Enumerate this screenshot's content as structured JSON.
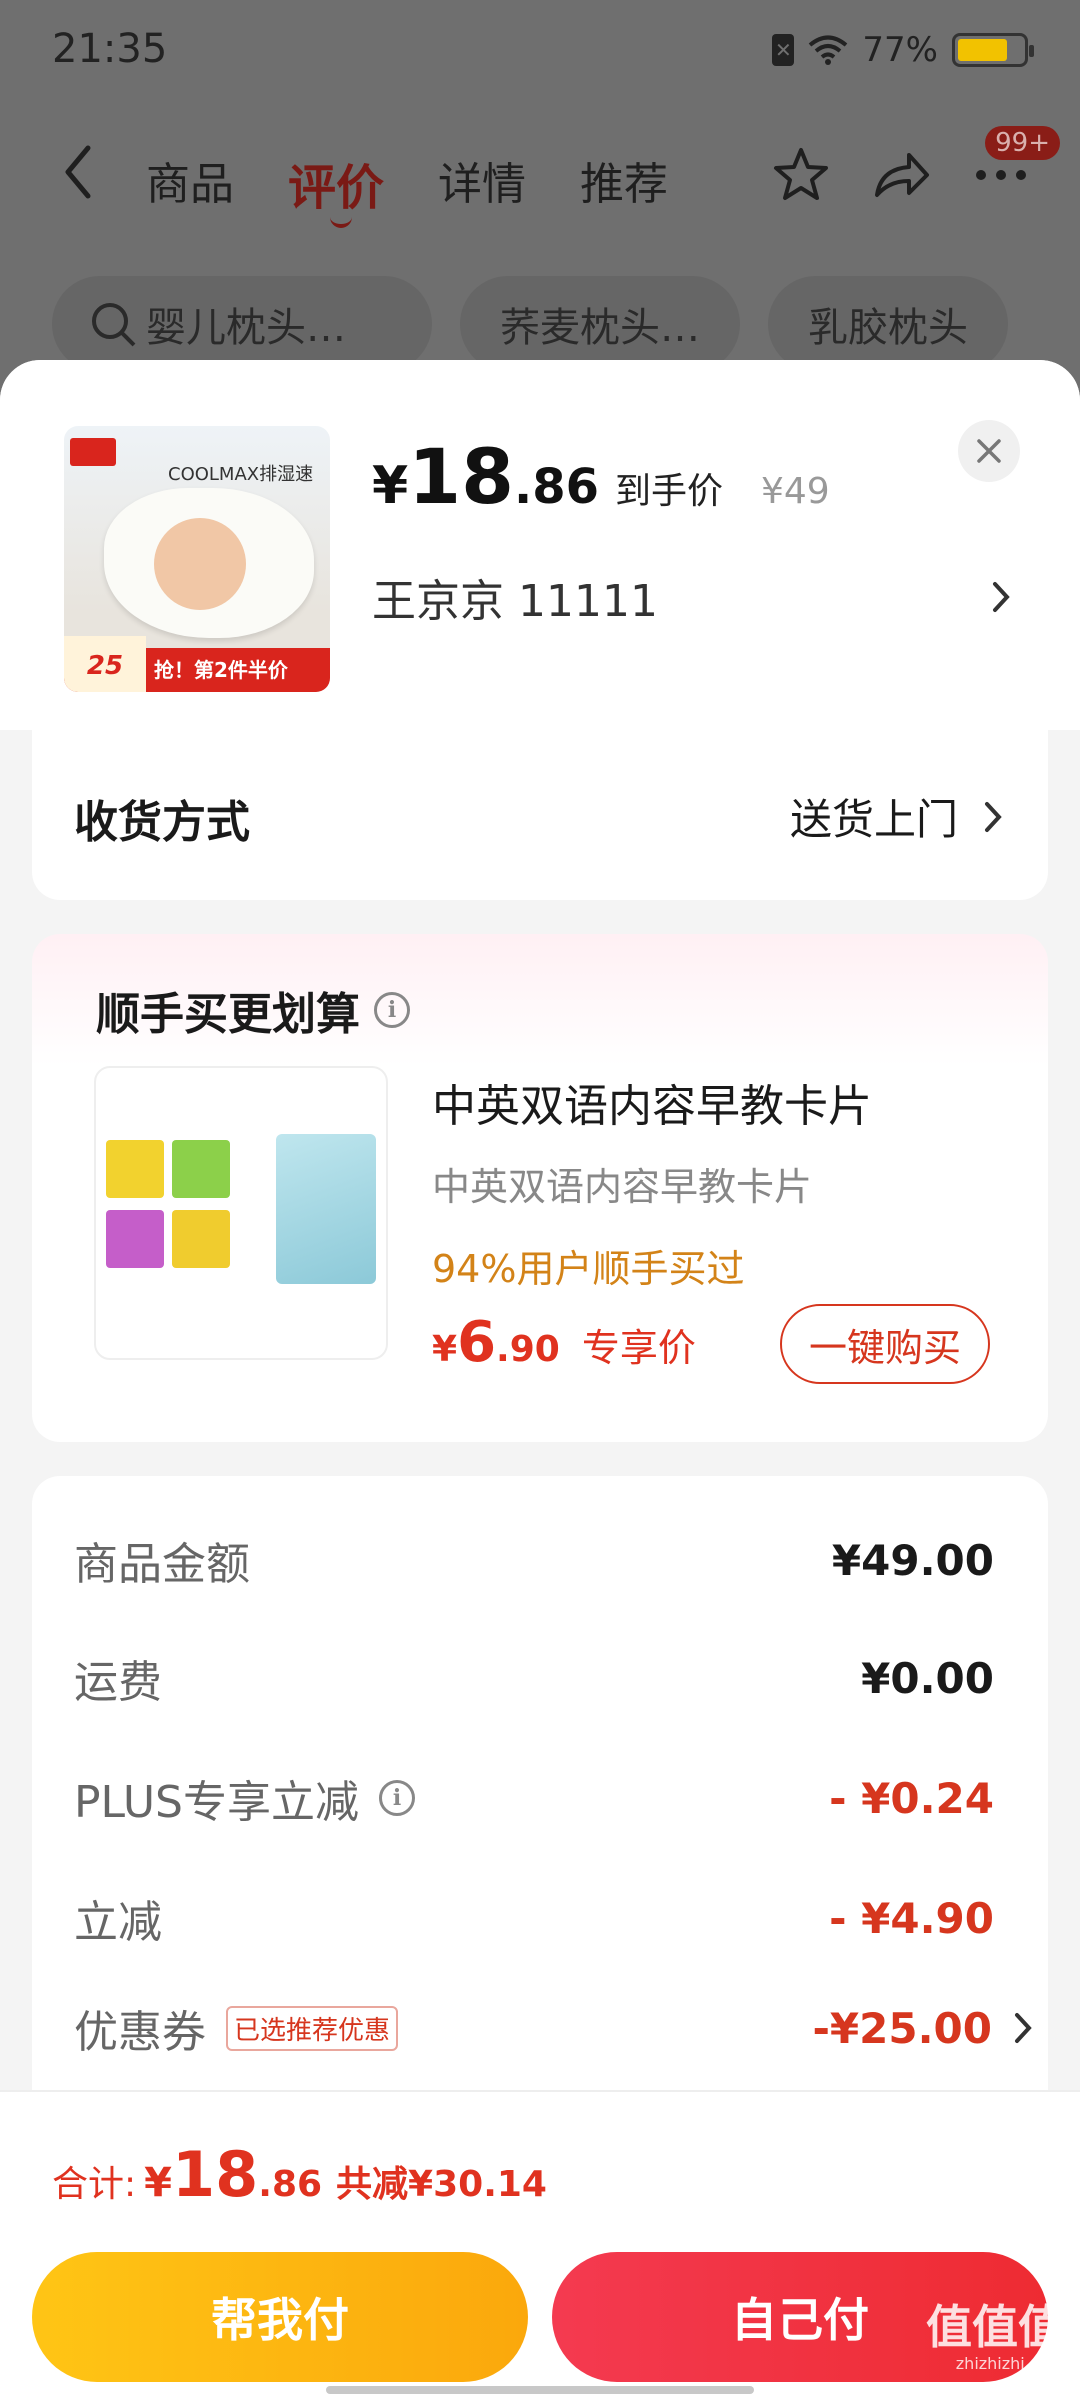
{
  "status_bar": {
    "time": "21:35",
    "battery": "77%",
    "battery_level": 0.77
  },
  "nav": {
    "tabs": [
      {
        "label": "商品",
        "active": false
      },
      {
        "label": "评价",
        "active": true
      },
      {
        "label": "详情",
        "active": false
      },
      {
        "label": "推荐",
        "active": false
      }
    ],
    "badge": "99+",
    "icons": [
      "back-icon",
      "star-icon",
      "share-icon",
      "more-icon"
    ]
  },
  "search_chips": [
    {
      "label": "婴儿枕头…",
      "icon": "search-icon"
    },
    {
      "label": "荞麦枕头…"
    },
    {
      "label": "乳胶枕头"
    }
  ],
  "product": {
    "image_text": "COOLMAX排湿速干",
    "image_promo": "抢！第2件半价",
    "image_price": "25",
    "price_yen": "¥",
    "price_int": "18",
    "price_dec": ".86",
    "price_label": "到手价",
    "original_price": "¥49",
    "address": "王京京  11111"
  },
  "delivery": {
    "label": "收货方式",
    "value": "送货上门"
  },
  "bundle": {
    "title": "顺手买更划算",
    "name": "中英双语内容早教卡片",
    "subtitle": "中英双语内容早教卡片",
    "stat": "94%用户顺手买过",
    "price_yen": "¥",
    "price_int": "6",
    "price_dec": ".90",
    "price_label": "专享价",
    "button": "一键购买"
  },
  "summary": {
    "rows": [
      {
        "label": "商品金额",
        "value": "¥49.00"
      },
      {
        "label": "运费",
        "value": "¥0.00"
      },
      {
        "label": "PLUS专享立减",
        "value": "- ¥0.24"
      },
      {
        "label": "立减",
        "value": "- ¥4.90"
      },
      {
        "label": "优惠券",
        "tag": "已选推荐优惠",
        "value": "-¥25.00"
      }
    ]
  },
  "footer": {
    "total_label": "合计:",
    "total_yen": "¥",
    "total_int": "18",
    "total_dec": ".86",
    "total_saving": "共减¥30.14",
    "help_pay": "帮我付",
    "self_pay": "自己付"
  },
  "watermark": {
    "main": "值值值",
    "sub": "zhizhizhi.com"
  },
  "colors": {
    "accent_red": "#e0321f",
    "help_yellow": "#ffc515",
    "pay_red": "#f43a50",
    "stat_orange": "#d38318"
  }
}
